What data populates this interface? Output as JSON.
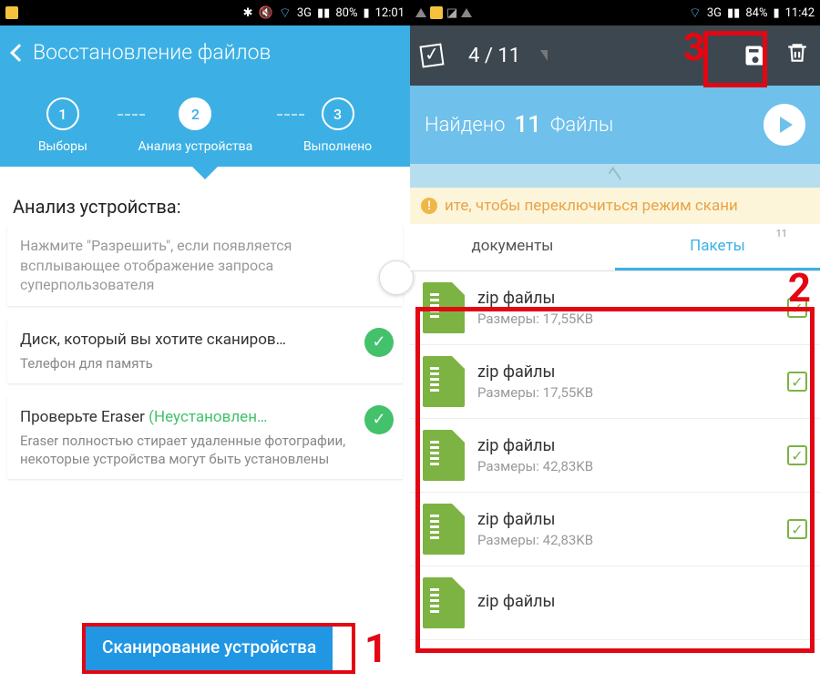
{
  "left": {
    "status": {
      "net": "3G",
      "battery": "80%",
      "time": "12:01"
    },
    "title": "Восстановление файлов",
    "steps": [
      {
        "n": "1",
        "label": "Выборы"
      },
      {
        "n": "2",
        "label": "Анализ устройства"
      },
      {
        "n": "3",
        "label": "Выполнено"
      }
    ],
    "analysis_header": "Анализ устройства:",
    "cards": [
      {
        "text": "Нажмите \"Разрешить\", если появляется всплывающее отображение запроса суперпользователя"
      },
      {
        "title": "Диск, который вы хотите сканиров…",
        "sub": "Телефон для память"
      },
      {
        "title_a": "Проверьте Eraser ",
        "title_b": "(Неустановлен…",
        "sub": "Eraser полностью стирает удаленные фотографии, некоторые устройства могут быть установлены"
      }
    ],
    "scan_button": "Сканирование устройства",
    "annot1": "1"
  },
  "right": {
    "status": {
      "net": "3G",
      "battery": "84%",
      "time": "11:42"
    },
    "selection": "4 / 11",
    "found_label_a": "Найдено",
    "found_count": "11",
    "found_label_b": "Файлы",
    "notice": "ите, чтобы переключиться режим скани",
    "tabs": [
      {
        "label": "документы",
        "badge": ""
      },
      {
        "label": "Пакеты",
        "badge": "11"
      }
    ],
    "files": [
      {
        "name": "zip файлы",
        "size": "Размеры: 17,55KB"
      },
      {
        "name": "zip файлы",
        "size": "Размеры: 17,55KB"
      },
      {
        "name": "zip файлы",
        "size": "Размеры: 42,83KB"
      },
      {
        "name": "zip файлы",
        "size": "Размеры: 42,83KB"
      },
      {
        "name": "zip файлы",
        "size": ""
      }
    ],
    "annot2": "2",
    "annot3": "3"
  }
}
